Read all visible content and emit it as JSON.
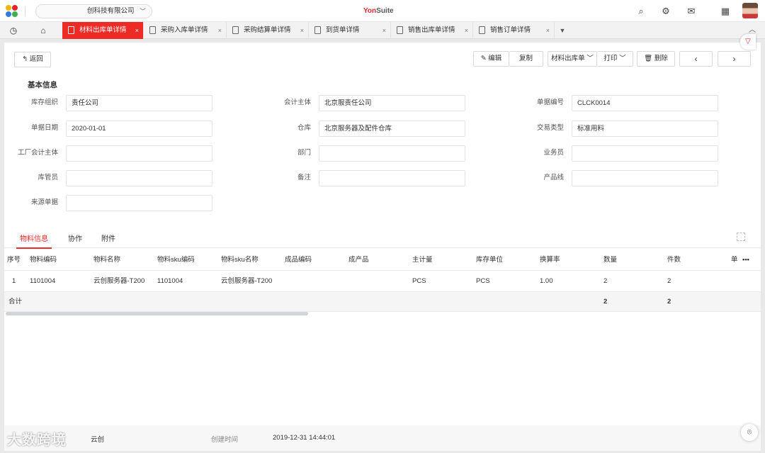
{
  "topbar": {
    "company": "创科技有限公司",
    "brand_yon": "Yon",
    "brand_suite": "Suite"
  },
  "tabs": [
    {
      "label": "材料出库单详情",
      "active": true
    },
    {
      "label": "采购入库单详情"
    },
    {
      "label": "采购结算单详情"
    },
    {
      "label": "到货单详情"
    },
    {
      "label": "销售出库单详情"
    },
    {
      "label": "销售订单详情"
    }
  ],
  "toolbar": {
    "back": "返回",
    "edit": "编辑",
    "copy": "复制",
    "doc_type": "材料出库单",
    "print": "打印",
    "delete": "删除"
  },
  "section": {
    "title": "基本信息"
  },
  "fields": {
    "inventory_org": {
      "label": "库存组织",
      "value": "责任公司"
    },
    "accounting_entity": {
      "label": "会计主体",
      "value": "北京服责任公司"
    },
    "doc_no": {
      "label": "单据编号",
      "value": "CLCK0014"
    },
    "doc_date": {
      "label": "单据日期",
      "value": "2020-01-01"
    },
    "warehouse": {
      "label": "仓库",
      "value": "北京服务器及配件仓库"
    },
    "trans_type": {
      "label": "交易类型",
      "value": "标准用料"
    },
    "factory_entity": {
      "label": "工厂会计主体",
      "value": ""
    },
    "department": {
      "label": "部门",
      "value": ""
    },
    "salesperson": {
      "label": "业务员",
      "value": ""
    },
    "keeper": {
      "label": "库管员",
      "value": ""
    },
    "remark": {
      "label": "备注",
      "value": ""
    },
    "product_line": {
      "label": "产品线",
      "value": ""
    },
    "source_doc": {
      "label": "来源单据",
      "value": ""
    }
  },
  "detail_tabs": [
    "物料信息",
    "协作",
    "附件"
  ],
  "table": {
    "headers": [
      "序号",
      "物料编码",
      "物料名称",
      "物料sku编码",
      "物料sku名称",
      "成品编码",
      "成产品",
      "主计量",
      "库存单位",
      "换算率",
      "数量",
      "件数",
      "单"
    ],
    "rows": [
      [
        "1",
        "1101004",
        "云创服务器-T200",
        "1101004",
        "云创服务器-T200",
        "",
        "",
        "PCS",
        "PCS",
        "1.00",
        "2",
        "2",
        ""
      ]
    ],
    "total": {
      "label": "合计",
      "qty": "2",
      "pieces": "2"
    }
  },
  "footer": {
    "creator_value": "云创",
    "created_time_label": "创建时间",
    "created_time_value": "2019-12-31 14:44:01"
  },
  "watermark": "大数跨境"
}
